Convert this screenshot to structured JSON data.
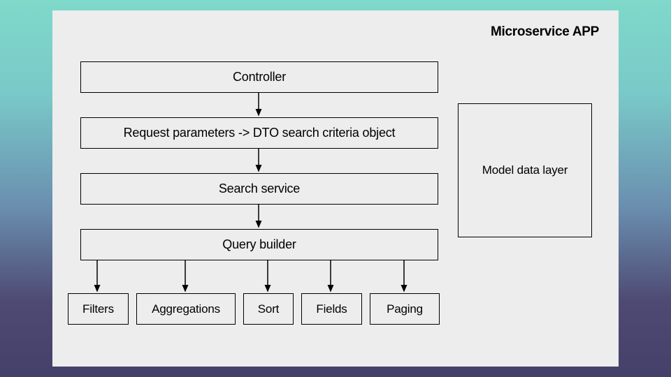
{
  "title": "Microservice APP",
  "flow": {
    "controller": "Controller",
    "dto": "Request parameters -> DTO search criteria object",
    "search_service": "Search service",
    "query_builder": "Query builder"
  },
  "branches": {
    "filters": "Filters",
    "aggregations": "Aggregations",
    "sort": "Sort",
    "fields": "Fields",
    "paging": "Paging"
  },
  "side": {
    "model_layer": "Model data layer"
  }
}
